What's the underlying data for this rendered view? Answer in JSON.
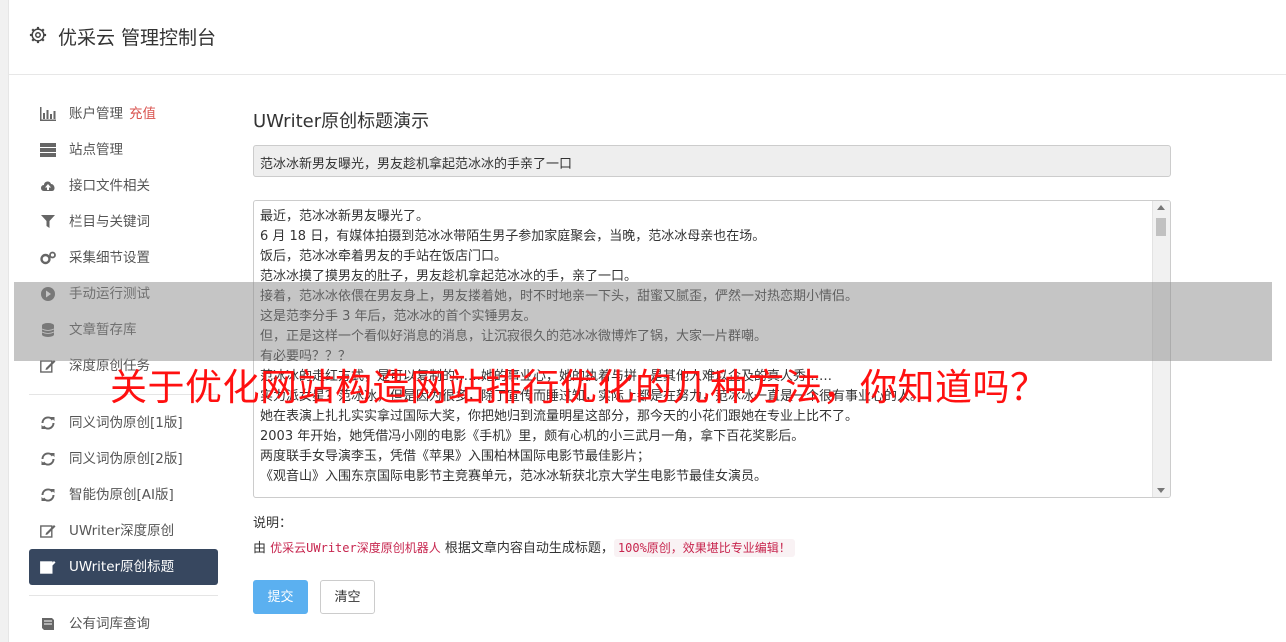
{
  "header": {
    "title": "优采云 管理控制台"
  },
  "sidebar": {
    "items": [
      {
        "label": "账户管理",
        "badge": "充值",
        "icon": "bar-chart-icon"
      },
      {
        "label": "站点管理",
        "icon": "server-icon"
      },
      {
        "label": "接口文件相关",
        "icon": "cloud-upload-icon"
      },
      {
        "label": "栏目与关键词",
        "icon": "filter-icon"
      },
      {
        "label": "采集细节设置",
        "icon": "cogs-icon"
      },
      {
        "label": "手动运行测试",
        "icon": "play-circle-icon"
      },
      {
        "label": "文章暂存库",
        "icon": "database-icon"
      },
      {
        "label": "深度原创任务",
        "icon": "edit-icon"
      },
      {
        "label": "同义词伪原创[1版]",
        "icon": "refresh-icon"
      },
      {
        "label": "同义词伪原创[2版]",
        "icon": "refresh-icon"
      },
      {
        "label": "智能伪原创[AI版]",
        "icon": "refresh-icon"
      },
      {
        "label": "UWriter深度原创",
        "icon": "edit-icon"
      },
      {
        "label": "UWriter原创标题",
        "icon": "edit-icon",
        "active": true
      },
      {
        "label": "公有词库查询",
        "icon": "book-icon"
      }
    ]
  },
  "main": {
    "page_title": "UWriter原创标题演示",
    "title_value": "范冰冰新男友曝光，男友趁机拿起范冰冰的手亲了一口",
    "content_lines": [
      "最近，范冰冰新男友曝光了。",
      "6 月 18 日，有媒体拍摄到范冰冰带陌生男子参加家庭聚会，当晚，范冰冰母亲也在场。",
      "饭后，范冰冰牵着男友的手站在饭店门口。",
      "范冰冰摸了摸男友的肚子，男友趁机拿起范冰冰的手，亲了一口。",
      "接着，范冰冰依偎在男友身上，男友搂着她，时不时地亲一下头，甜蜜又腻歪，俨然一对热恋期小情侣。",
      "这是范李分手 3 年后，范冰冰的首个实锤男友。",
      "但，正是这样一个看似好消息的消息，让沉寂很久的范冰冰微博炸了锅，大家一片群嘲。",
      "有必要吗？？？",
      "范冰冰的走红方式，是可以复制的……她的事业心，她的执着与拼，是其他人难以企及的真人秀……",
      "实力派女星？范冰冰，但是因为很多，除了宣传而睡过知，实际上都是在努力，范冰冰一直是一个很有事业心的人。",
      "她在表演上扎扎实实拿过国际大奖，你把她归到流量明星这部分，那今天的小花们跟她在专业上比不了。",
      "2003 年开始，她凭借冯小刚的电影《手机》里，颇有心机的小三武月一角，拿下百花奖影后。",
      "两度联手女导演李玉，凭借《苹果》入围柏林国际电影节最佳影片；",
      "《观音山》入围东京国际电影节主竞赛单元，范冰冰斩获北京大学生电影节最佳女演员。"
    ],
    "explain_label": "说明：",
    "explain_prefix": "由",
    "explain_code": "优采云UWriter深度原创机器人",
    "explain_middle": "根据文章内容自动生成标题，",
    "explain_highlight": "100%原创，效果堪比专业编辑！",
    "submit_label": "提交",
    "clear_label": "清空"
  },
  "overlay": {
    "title": "关于优化网站构造网站排行优化的几种方法，你知道吗？"
  },
  "colors": {
    "active_nav": "#37475f",
    "submit": "#5bb0f0",
    "overlay_text": "#ff1010",
    "badge": "#d9534f"
  }
}
